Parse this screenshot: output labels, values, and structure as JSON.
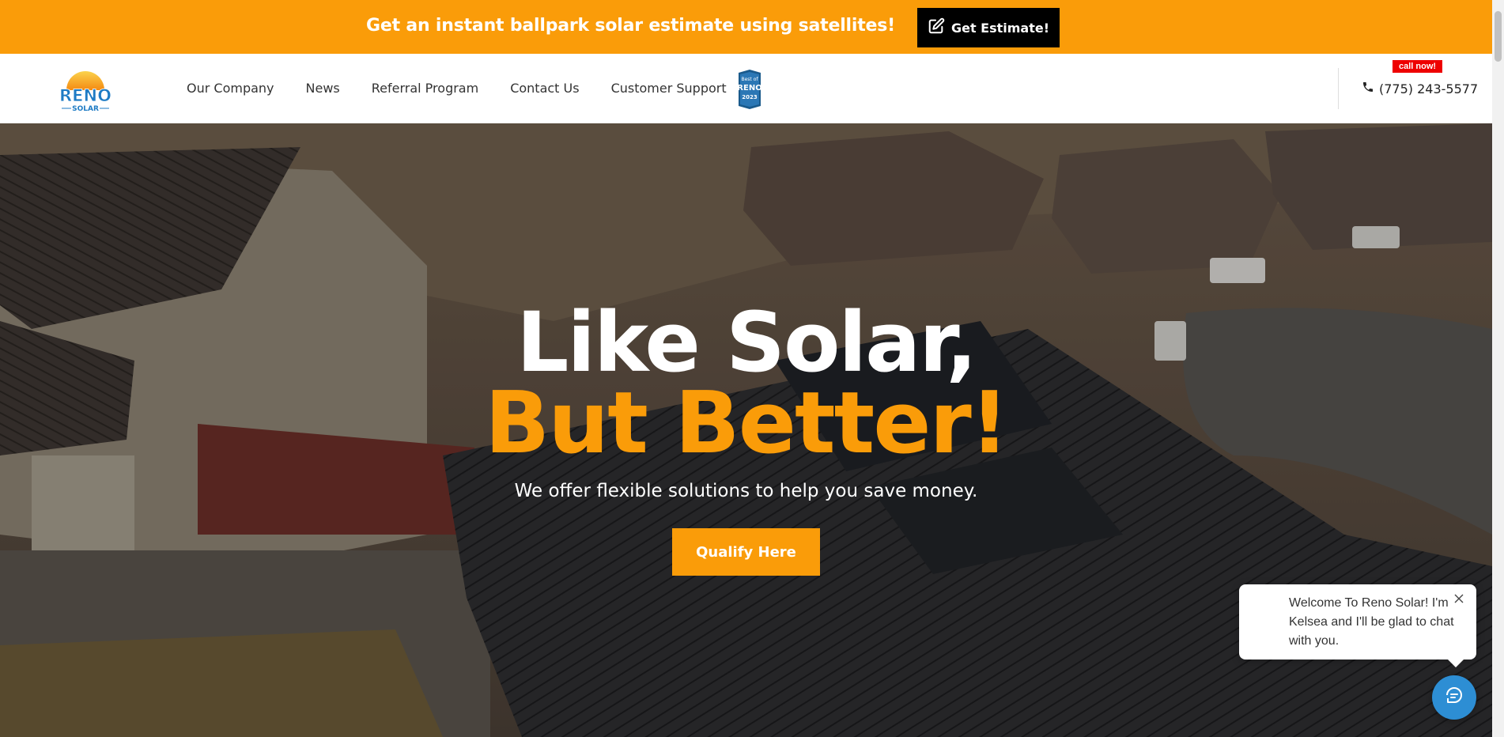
{
  "promo": {
    "text": "Get an instant ballpark solar estimate using satellites!",
    "button_label": "Get Estimate!",
    "icon": "edit-icon"
  },
  "header": {
    "logo_text_main": "RENO",
    "logo_text_sub": "SOLAR",
    "nav": [
      {
        "label": "Our Company"
      },
      {
        "label": "News"
      },
      {
        "label": "Referral Program"
      },
      {
        "label": "Contact Us"
      },
      {
        "label": "Customer Support"
      }
    ],
    "badge_text_top": "Best of",
    "badge_text_mid": "RENO",
    "badge_year": "2023",
    "call_now": "call now!",
    "phone": "(775) 243-5577",
    "phone_icon": "phone-icon"
  },
  "hero": {
    "title_line1": "Like Solar,",
    "title_line2": "But Better!",
    "subtitle": "We offer flexible solutions to help you save money.",
    "cta_label": "Qualify Here"
  },
  "chat": {
    "message": "Welcome To Reno Solar! I'm Kelsea and I'll be glad to chat with you.",
    "close_icon": "close-icon",
    "launcher_icon": "chat-icon"
  },
  "colors": {
    "accent": "#fa9c09",
    "black": "#000000",
    "call_now_red": "#ee0000",
    "chat_blue": "#2d8ed4"
  }
}
